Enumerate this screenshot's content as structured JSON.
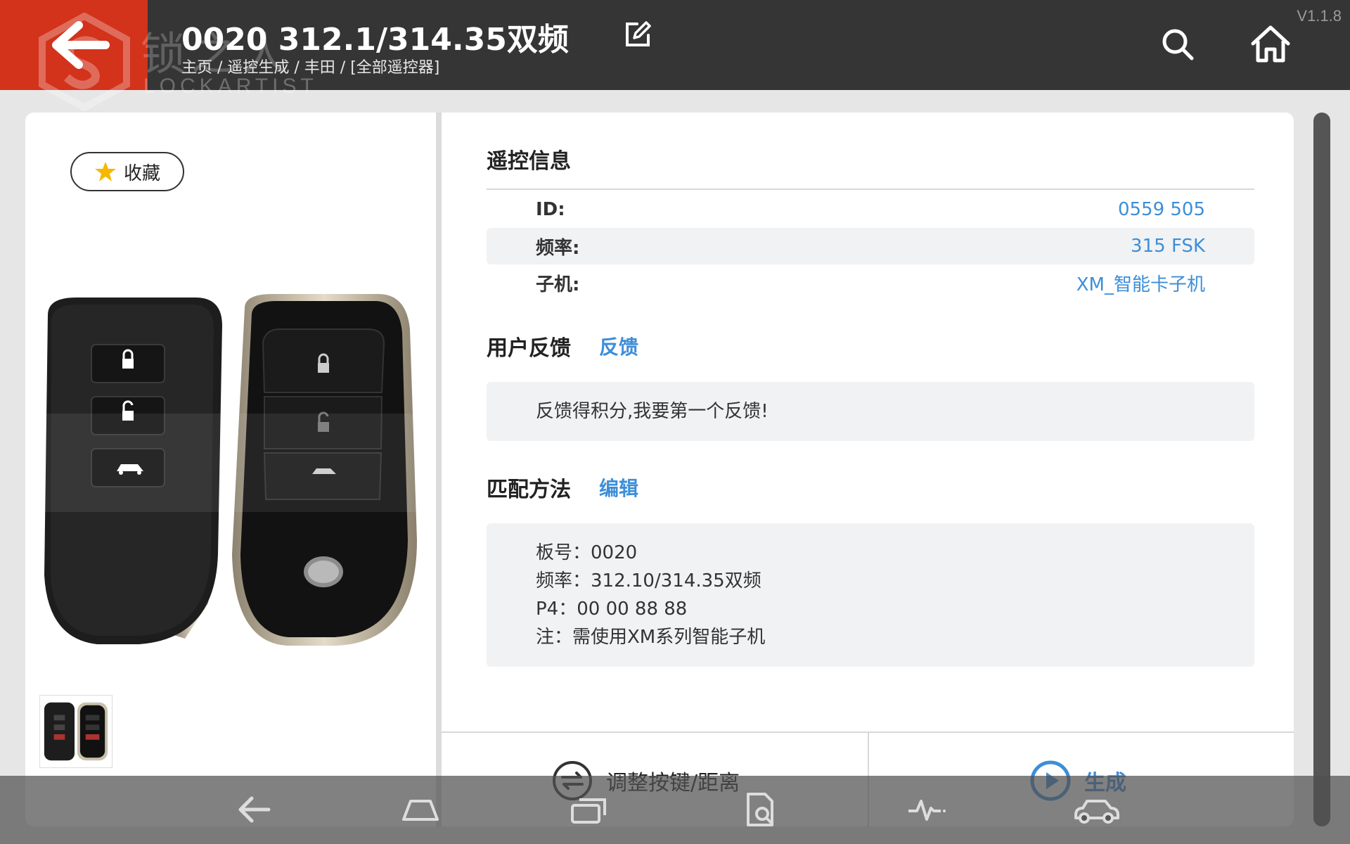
{
  "header": {
    "title": "0020 312.1/314.35双频",
    "breadcrumb": "主页 / 遥控生成 / 丰田 / [全部遥控器]",
    "version": "V1.1.8",
    "watermark_cn": "锁之人",
    "watermark_en": "LOCKARTIST"
  },
  "left": {
    "favorite_label": "收藏"
  },
  "remote_info": {
    "title": "遥控信息",
    "rows": [
      {
        "label": "ID:",
        "value": "0559 505"
      },
      {
        "label": "频率:",
        "value": "315 FSK"
      },
      {
        "label": "子机:",
        "value": "XM_智能卡子机"
      }
    ]
  },
  "feedback": {
    "title": "用户反馈",
    "link": "反馈",
    "text": "反馈得积分,我要第一个反馈!"
  },
  "match": {
    "title": "匹配方法",
    "link": "编辑",
    "lines": [
      "板号：0020",
      "频率：312.10/314.35双频",
      "P4：00 00 88 88",
      "注：需使用XM系列智能子机"
    ]
  },
  "actions": {
    "adjust_label": "调整按键/距离",
    "generate_label": "生成"
  },
  "colors": {
    "header_bg": "#353535",
    "back_bg": "#d3321b",
    "accent": "#3d8ed8",
    "star": "#f5b800"
  }
}
